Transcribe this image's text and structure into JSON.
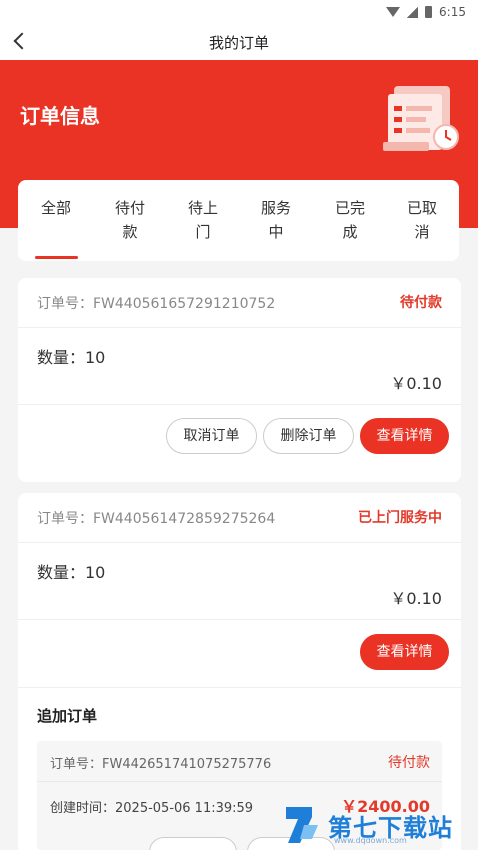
{
  "status_bar": {
    "time": "6:15"
  },
  "header": {
    "title": "我的订单"
  },
  "hero": {
    "title": "订单信息"
  },
  "tabs": [
    {
      "line1": "全部",
      "line2": ""
    },
    {
      "line1": "待付",
      "line2": "款"
    },
    {
      "line1": "待上",
      "line2": "门"
    },
    {
      "line1": "服务",
      "line2": "中"
    },
    {
      "line1": "已完",
      "line2": "成"
    },
    {
      "line1": "已取",
      "line2": "消"
    }
  ],
  "orders": [
    {
      "order_no": "订单号：FW440561657291210752",
      "status": "待付款",
      "quantity": "数量：10",
      "price": "￥0.10",
      "buttons": {
        "cancel": "取消订单",
        "delete": "删除订单",
        "detail": "查看详情"
      }
    },
    {
      "order_no": "订单号：FW440561472859275264",
      "status": "已上门服务中",
      "quantity": "数量：10",
      "price": "￥0.10",
      "buttons": {
        "detail": "查看详情"
      },
      "additional": {
        "title": "追加订单",
        "order_no": "订单号：FW442651741075275776",
        "status": "待付款",
        "created": "创建时间：2025-05-06 11:39:59",
        "price": "￥2400.00"
      }
    }
  ],
  "watermark": {
    "text": "第七下载站",
    "url": "www.dqdown.com"
  },
  "colors": {
    "accent": "#ea3324",
    "status_red": "#e23a2b",
    "background": "#f4f4f4",
    "watermark_blue": "#1f7ed8"
  }
}
